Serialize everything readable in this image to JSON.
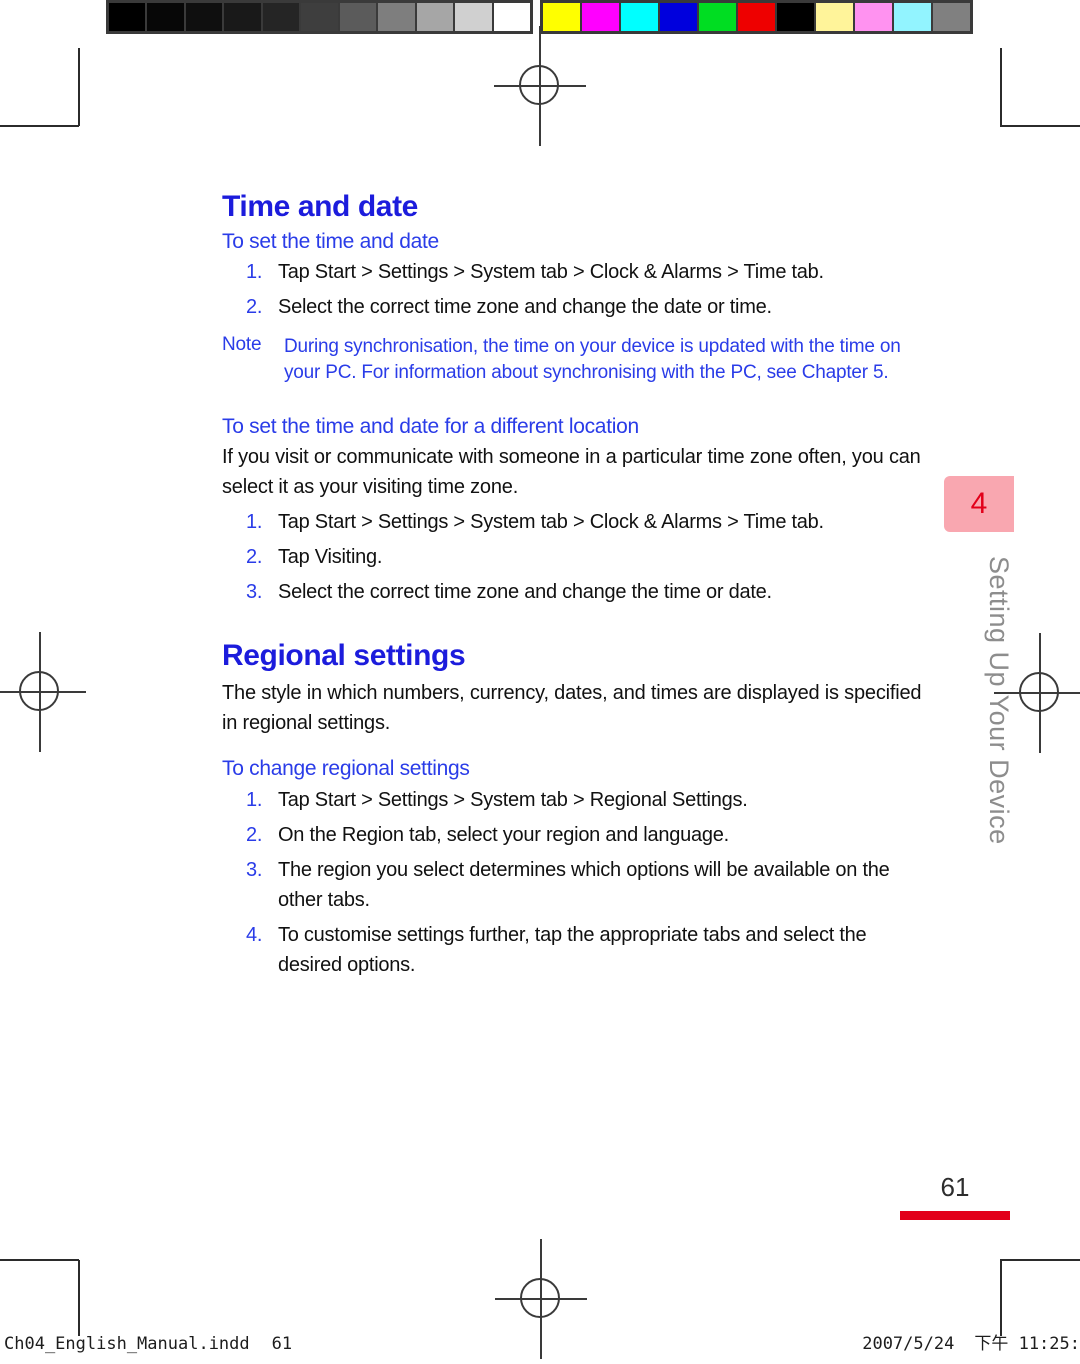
{
  "calibration": {
    "grayscale_label": "grayscale-step-wedge",
    "grayscale_swatches": [
      "#000000",
      "#070707",
      "#0f0f0f",
      "#191919",
      "#252525",
      "#3e3e3e",
      "#5b5b5b",
      "#7e7e7e",
      "#a6a6a6",
      "#d0d0d0",
      "#ffffff"
    ],
    "color_label": "process-colour-bar",
    "color_swatches": [
      "#ffff00",
      "#ff00ff",
      "#00ffff",
      "#0000dd",
      "#00dd22",
      "#ee0000",
      "#000000",
      "#fff49a",
      "#ff92f0",
      "#92f4ff",
      "#808080"
    ]
  },
  "page": {
    "sections": [
      {
        "title": "Time and date",
        "subsections": [
          {
            "subhead": "To set the time and date",
            "intro": [],
            "steps": [
              "Tap Start > Settings > System tab > Clock & Alarms > Time tab.",
              "Select the correct time zone and change the date or time."
            ],
            "note": {
              "label": "Note",
              "text": "During synchronisation, the time on your device is updated with the time on your PC. For information about synchronising with the PC, see Chapter 5."
            }
          },
          {
            "subhead": "To set the time and date for a different location",
            "intro": [
              "If you visit or communicate with someone in a particular time zone often, you can select it as your visiting time zone."
            ],
            "steps": [
              "Tap Start > Settings > System tab > Clock & Alarms > Time tab.",
              "Tap Visiting.",
              "Select the correct time zone and change the time or date."
            ]
          }
        ]
      },
      {
        "title": "Regional settings",
        "subsections": [
          {
            "subhead": "",
            "intro": [
              "The style in which numbers, currency, dates, and times are displayed is specified in regional settings."
            ],
            "steps": []
          },
          {
            "subhead": "To change regional settings",
            "intro": [],
            "steps": [
              "Tap Start > Settings > System tab > Regional Settings.",
              "On the Region tab, select your region and language.",
              "The region you select determines which options will be available on the other tabs.",
              "To customise settings further, tap the appropriate tabs and select the desired options."
            ]
          }
        ]
      }
    ],
    "chapter_tab": {
      "number": "4",
      "running_head": "Setting Up Your Device",
      "tab_color": "#f9a7b0",
      "number_color": "#e2001a",
      "running_head_color": "#8d8d8d"
    },
    "folio": {
      "number": "61",
      "rule_color": "#e2001a"
    },
    "imposition_footer": {
      "filename": "Ch04_English_Manual.indd",
      "page_ref": "61",
      "date": "2007/5/24",
      "time": "下午 11:25:"
    },
    "colors": {
      "heading_blue": "#1c1cdc",
      "subhead_blue": "#2a3ce8",
      "body_black": "#111111"
    }
  }
}
